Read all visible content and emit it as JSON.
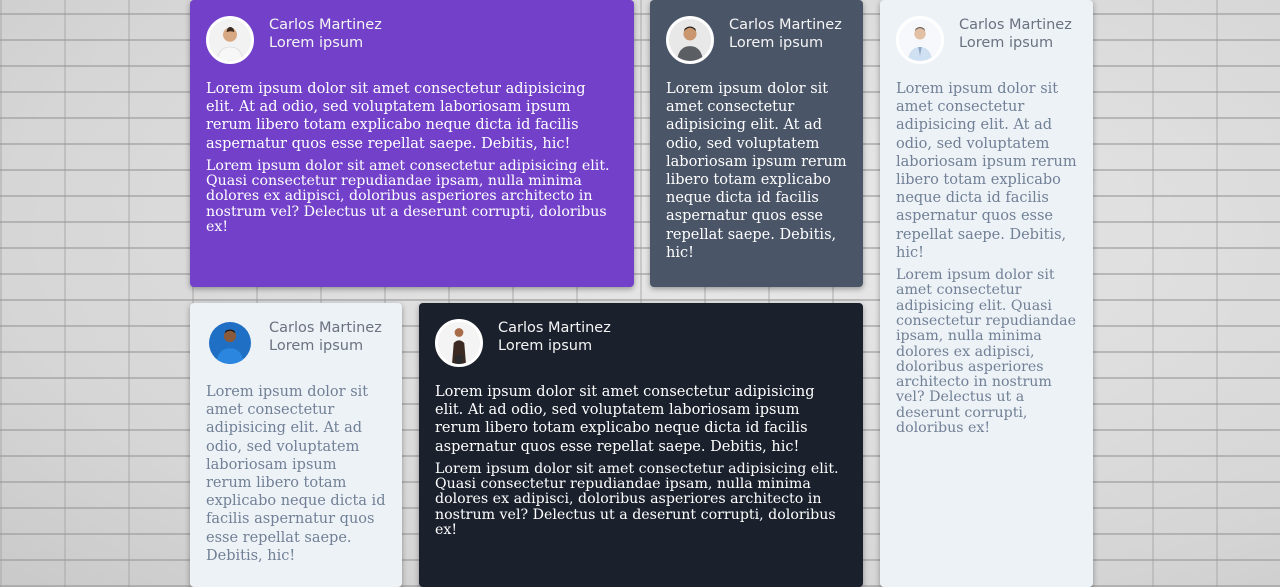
{
  "cards": [
    {
      "name": "Carlos Martinez",
      "role": "Lorem ipsum",
      "p1": "Lorem ipsum dolor sit amet consectetur adipisicing elit. At ad odio, sed voluptatem laboriosam ipsum rerum libero totam explicabo neque dicta id facilis aspernatur quos esse repellat saepe. Debitis, hic!",
      "p2": "Lorem ipsum dolor sit amet consectetur adipisicing elit. Quasi consectetur repudiandae ipsam, nulla minima dolores ex adipisci, doloribus asperiores architecto in nostrum vel? Delectus ut a deserunt corrupti, doloribus ex!",
      "color": "#7240c9"
    },
    {
      "name": "Carlos Martinez",
      "role": "Lorem ipsum",
      "p1": "Lorem ipsum dolor sit amet consectetur adipisicing elit. At ad odio, sed voluptatem laboriosam ipsum rerum libero totam explicabo neque dicta id facilis aspernatur quos esse repellat saepe. Debitis, hic!",
      "color": "#4a5568"
    },
    {
      "name": "Carlos Martinez",
      "role": "Lorem ipsum",
      "p1": "Lorem ipsum dolor sit amet consectetur adipisicing elit. At ad odio, sed voluptatem laboriosam ipsum rerum libero totam explicabo neque dicta id facilis aspernatur quos esse repellat saepe. Debitis, hic!",
      "p2": "Lorem ipsum dolor sit amet consectetur adipisicing elit. Quasi consectetur repudiandae ipsam, nulla minima dolores ex adipisci, doloribus asperiores architecto in nostrum vel? Delectus ut a deserunt corrupti, doloribus ex!",
      "color": "#edf2f7"
    },
    {
      "name": "Carlos Martinez",
      "role": "Lorem ipsum",
      "p1": "Lorem ipsum dolor sit amet consectetur adipisicing elit. At ad odio, sed voluptatem laboriosam ipsum rerum libero totam explicabo neque dicta id facilis aspernatur quos esse repellat saepe. Debitis, hic!",
      "color": "#edf2f7"
    },
    {
      "name": "Carlos Martinez",
      "role": "Lorem ipsum",
      "p1": "Lorem ipsum dolor sit amet consectetur adipisicing elit. At ad odio, sed voluptatem laboriosam ipsum rerum libero totam explicabo neque dicta id facilis aspernatur quos esse repellat saepe. Debitis, hic!",
      "p2": "Lorem ipsum dolor sit amet consectetur adipisicing elit. Quasi consectetur repudiandae ipsam, nulla minima dolores ex adipisci, doloribus asperiores architecto in nostrum vel? Delectus ut a deserunt corrupti, doloribus ex!",
      "color": "#1a202c"
    }
  ]
}
